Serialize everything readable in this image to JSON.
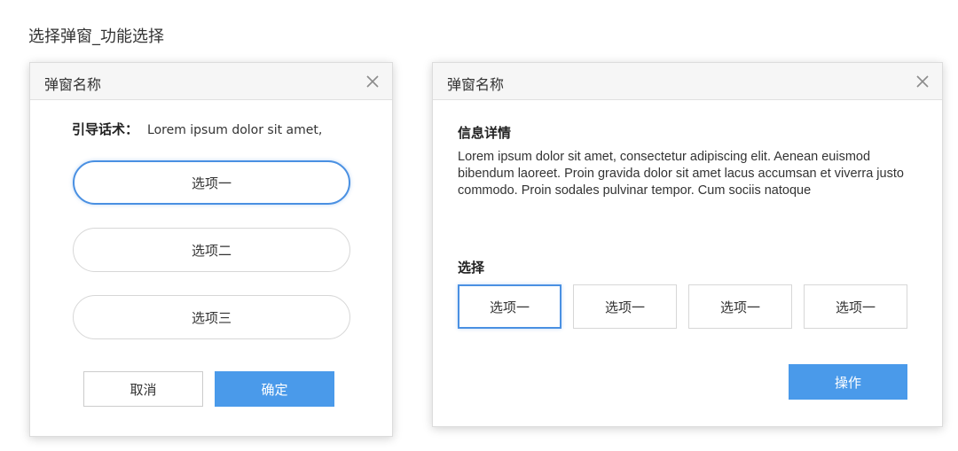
{
  "page_title": "选择弹窗_功能选择",
  "colors": {
    "primary": "#4a9aea",
    "selected_border": "#4a90e2",
    "header_bg": "#f6f6f6"
  },
  "dialog1": {
    "title": "弹窗名称",
    "close_icon": "close-icon",
    "guide_label": "引导话术：",
    "guide_text": "Lorem ipsum dolor sit amet,",
    "options": [
      {
        "label": "选项一",
        "selected": true
      },
      {
        "label": "选项二",
        "selected": false
      },
      {
        "label": "选项三",
        "selected": false
      }
    ],
    "cancel_label": "取消",
    "confirm_label": "确定"
  },
  "dialog2": {
    "title": "弹窗名称",
    "close_icon": "close-icon",
    "info_title": "信息详情",
    "info_text": "Lorem ipsum dolor sit amet, consectetur adipiscing elit. Aenean euismod bibendum laoreet. Proin gravida dolor sit amet lacus accumsan et viverra justo commodo. Proin sodales pulvinar tempor. Cum sociis natoque",
    "select_title": "选择",
    "options": [
      {
        "label": "选项一",
        "selected": true
      },
      {
        "label": "选项一",
        "selected": false
      },
      {
        "label": "选项一",
        "selected": false
      },
      {
        "label": "选项一",
        "selected": false
      }
    ],
    "action_label": "操作"
  }
}
